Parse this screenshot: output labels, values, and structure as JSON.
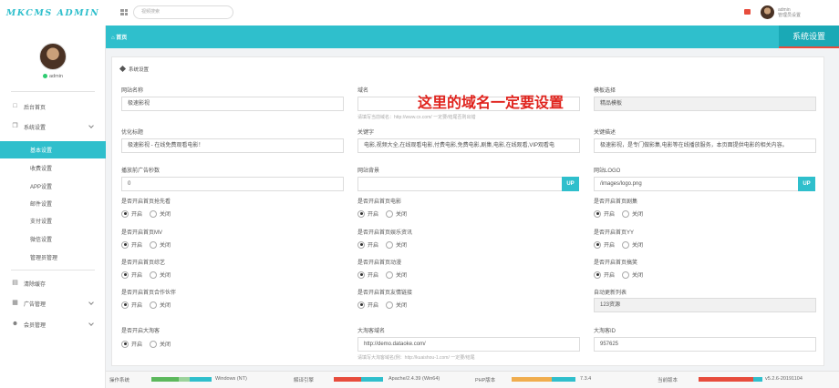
{
  "app": {
    "logo": "MKCMS ADMIN"
  },
  "search": {
    "placeholder": "视频搜索"
  },
  "user": {
    "name": "admin",
    "top_name": "admin",
    "role": "管理员设置"
  },
  "sidebar": {
    "items": [
      {
        "label": "后台首页",
        "icon": "laptop-icon"
      },
      {
        "label": "系统设置",
        "icon": "copy-icon"
      },
      {
        "label": "清除缓存",
        "icon": "trash-icon"
      },
      {
        "label": "广告管理",
        "icon": "image-icon"
      },
      {
        "label": "会员管理",
        "icon": "users-icon"
      }
    ],
    "sub_items": [
      "基本设置",
      "收费设置",
      "APP设置",
      "邮件设置",
      "支付设置",
      "微信设置",
      "管理员管理"
    ]
  },
  "breadcrumb": {
    "home": "首页",
    "section": "系统设置"
  },
  "panel": {
    "title": "系统设置"
  },
  "overlay_text": "这里的域名一定要设置",
  "fields": {
    "site_name": {
      "label": "网站名称",
      "value": "极速影视"
    },
    "domain": {
      "label": "域名",
      "value": "",
      "hint": "请填写当前域名：http://www.cx.com/ 一定要/结尾否则出错"
    },
    "template": {
      "label": "模板选择",
      "value": "精品模板"
    },
    "seo_title": {
      "label": "优化标题",
      "value": "极速影视 - 在线免费观看电影！"
    },
    "keywords": {
      "label": "关键字",
      "value": "电影,视频大全,在线观看电影,付费电影,免费电影,剧集,电影,在线观看,VIP观看电"
    },
    "description": {
      "label": "关键描述",
      "value": "极速影视，是专门做影集,电影等在线播放服务，本页面提供电影的相关内容。"
    },
    "ad_seconds": {
      "label": "播放前广告秒数",
      "value": "0"
    },
    "site_bg": {
      "label": "网站背景",
      "value": "",
      "button": "UP"
    },
    "site_logo": {
      "label": "网站LOGO",
      "value": "/images/logo.png",
      "button": "UP"
    },
    "collect_list": {
      "label": "自动更新列表",
      "value": "123资源"
    },
    "dtk_domain": {
      "label": "大淘客域名",
      "value": "http://demo.dataoke.com/",
      "hint": "请填写大淘客域名(例：http://kuaishou-1.com/ 一定要/结尾"
    },
    "dtk_id": {
      "label": "大淘客ID",
      "value": "957625"
    }
  },
  "radio_options": {
    "on": "开启",
    "off": "关闭"
  },
  "toggles": [
    {
      "label": "是否开启首页抢先看",
      "on": true
    },
    {
      "label": "是否开启首页电影",
      "on": true
    },
    {
      "label": "是否开启首页剧集",
      "on": true
    },
    {
      "label": "是否开启首页MV",
      "on": true
    },
    {
      "label": "是否开启首页娱乐资讯",
      "on": true
    },
    {
      "label": "是否开启首页YY",
      "on": true
    },
    {
      "label": "是否开启首页综艺",
      "on": true
    },
    {
      "label": "是否开启首页动漫",
      "on": true
    },
    {
      "label": "是否开启首页搞笑",
      "on": true
    },
    {
      "label": "是否开启首页合作伙伴",
      "on": true
    },
    {
      "label": "是否开启首页友情链接",
      "on": true
    },
    {
      "label": "是否开启大淘客",
      "on": true
    }
  ],
  "statusbar": [
    {
      "label": "操作系统",
      "value": "Windows (NT)"
    },
    {
      "label": "解译引擎",
      "value": "Apache/2.4.39 (Win64)"
    },
    {
      "label": "PHP版本",
      "value": "7.3.4"
    },
    {
      "label": "当前版本",
      "value": "v5.2.6-20191104"
    }
  ],
  "colors": {
    "accent": "#2fbfcc",
    "accent_dark": "#1aa9b6",
    "alert": "#e0241e"
  }
}
